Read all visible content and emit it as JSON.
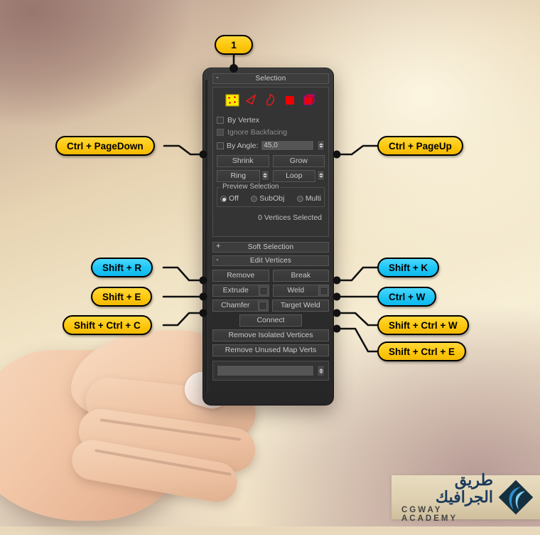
{
  "background": {
    "accent_yellow": "#ffc90f",
    "accent_cyan": "#21c7f5",
    "panel_dark": "#343434"
  },
  "callouts": {
    "step_number": "1",
    "left": [
      {
        "label": "Ctrl + PageDown",
        "color": "yellow"
      },
      {
        "label": "Shift + R",
        "color": "cyan"
      },
      {
        "label": "Shift + E",
        "color": "yellow"
      },
      {
        "label": "Shift + Ctrl + C",
        "color": "yellow"
      }
    ],
    "right": [
      {
        "label": "Ctrl + PageUp",
        "color": "yellow"
      },
      {
        "label": "Shift + K",
        "color": "cyan"
      },
      {
        "label": "Ctrl + W",
        "color": "cyan"
      },
      {
        "label": "Shift + Ctrl + W",
        "color": "yellow"
      },
      {
        "label": "Shift + Ctrl + E",
        "color": "yellow"
      }
    ]
  },
  "panel": {
    "selection": {
      "title": "Selection",
      "toggle": "-",
      "subobject_icons": [
        "vertex-icon",
        "edge-icon",
        "border-icon",
        "polygon-icon",
        "element-icon"
      ],
      "by_vertex": "By Vertex",
      "ignore_backfacing": "Ignore Backfacing",
      "by_angle_label": "By Angle:",
      "by_angle_value": "45,0",
      "shrink": "Shrink",
      "grow": "Grow",
      "ring": "Ring",
      "loop": "Loop",
      "preview_group": "Preview Selection",
      "preview_off": "Off",
      "preview_subobj": "SubObj",
      "preview_multi": "Multi",
      "status": "0 Vertices Selected"
    },
    "soft_selection": {
      "title": "Soft Selection",
      "toggle": "+"
    },
    "edit_vertices": {
      "title": "Edit Vertices",
      "toggle": "-",
      "remove": "Remove",
      "break": "Break",
      "extrude": "Extrude",
      "weld": "Weld",
      "chamfer": "Chamfer",
      "target_weld": "Target Weld",
      "connect": "Connect",
      "remove_isolated": "Remove Isolated Vertices",
      "remove_unused": "Remove Unused Map Verts",
      "weld_threshold": ""
    }
  },
  "logo": {
    "arabic": "طريق الجرافيك",
    "english": "CGWAY ACADEMY",
    "mark": "diamond-logo-icon"
  }
}
